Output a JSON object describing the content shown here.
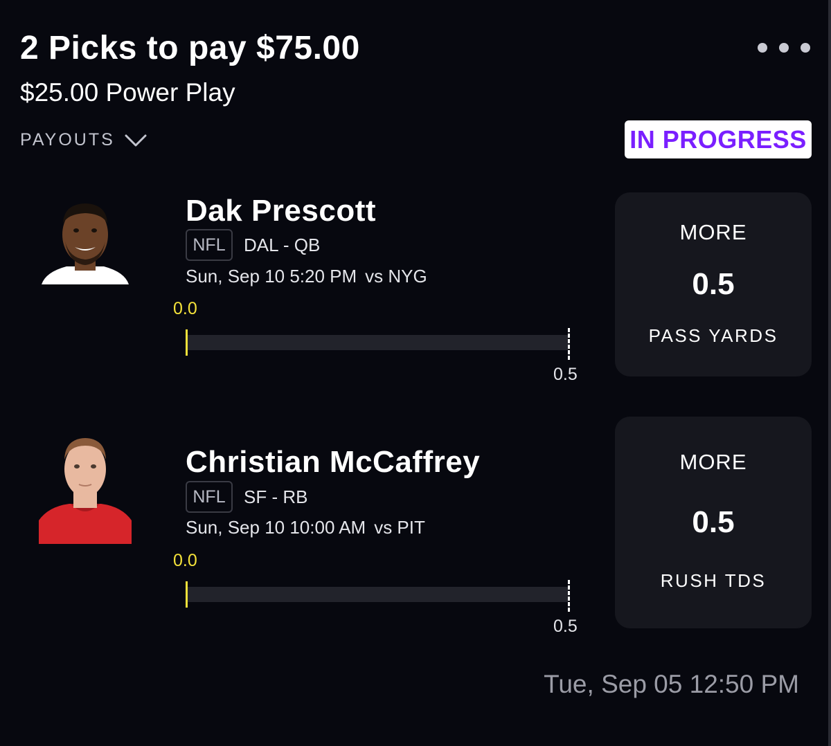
{
  "header": {
    "title": "2 Picks to pay $75.00",
    "subtitle": "$25.00 Power Play",
    "payouts_label": "PAYOUTS",
    "status": "IN PROGRESS"
  },
  "picks": [
    {
      "name": "Dak Prescott",
      "league": "NFL",
      "team_position": "DAL - QB",
      "game_time": "Sun, Sep 10 5:20 PM",
      "opponent": "vs NYG",
      "current_value": "0.0",
      "target_value": "0.5",
      "progress_fraction": 0,
      "direction": "MORE",
      "line": "0.5",
      "stat": "PASS YARDS",
      "avatar": {
        "skin": "#6b4228",
        "jersey": "#ffffff",
        "hair": "#1a120c"
      }
    },
    {
      "name": "Christian McCaffrey",
      "league": "NFL",
      "team_position": "SF - RB",
      "game_time": "Sun, Sep 10 10:00 AM",
      "opponent": "vs PIT",
      "current_value": "0.0",
      "target_value": "0.5",
      "progress_fraction": 0,
      "direction": "MORE",
      "line": "0.5",
      "stat": "RUSH TDS",
      "avatar": {
        "skin": "#e8b9a0",
        "jersey": "#d6252a",
        "hair": "#8a5a3a"
      }
    }
  ],
  "footer": {
    "timestamp": "Tue, Sep 05 12:50 PM"
  },
  "colors": {
    "background": "#07080f",
    "accent_purple": "#7a1fff",
    "progress_yellow": "#f4e23a",
    "card": "#16171e"
  }
}
